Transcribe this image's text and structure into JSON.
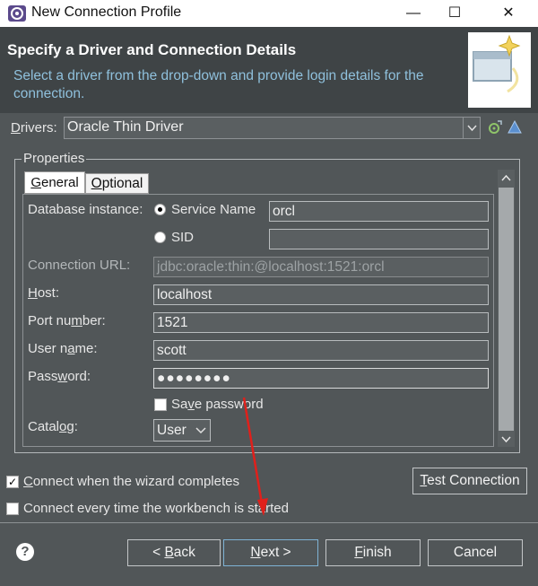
{
  "window": {
    "title": "New Connection Profile",
    "minimize_glyph": "—",
    "maximize_glyph": "☐",
    "close_glyph": "✕"
  },
  "header": {
    "title": "Specify a Driver and Connection Details",
    "description": "Select a driver from the drop-down and provide login details for the connection."
  },
  "drivers": {
    "label_first": "D",
    "label_rest": "rivers:",
    "selected": "Oracle Thin Driver"
  },
  "properties": {
    "group_label": "Properties",
    "tabs": [
      {
        "label_first": "G",
        "label_rest": "eneral",
        "active": true
      },
      {
        "label_first": "O",
        "label_rest": "ptional",
        "active": false
      }
    ],
    "database_instance_label": "Database instance:",
    "service_name_label": "Service Name",
    "service_name_value": "orcl",
    "sid_label": "SID",
    "sid_value": "",
    "connection_url_label": "Connection URL:",
    "connection_url_value": "jdbc:oracle:thin:@localhost:1521:orcl",
    "host_label_first": "H",
    "host_label_rest": "ost:",
    "host_value": "localhost",
    "port_label_pre": "Port nu",
    "port_label_ul": "m",
    "port_label_post": "ber:",
    "port_value": "1521",
    "username_label_pre": "User n",
    "username_label_ul": "a",
    "username_label_post": "me:",
    "username_value": "scott",
    "password_label_pre": "Pass",
    "password_label_ul": "w",
    "password_label_post": "ord:",
    "password_value": "●●●●●●●●",
    "save_password_pre": "Sa",
    "save_password_ul": "v",
    "save_password_post": "e password",
    "catalog_label_pre": "Catal",
    "catalog_label_ul": "o",
    "catalog_label_post": "g:",
    "catalog_value": "User"
  },
  "options": {
    "connect_on_finish_ul": "C",
    "connect_on_finish_rest": "onnect when the wizard completes",
    "connect_on_finish_checked": true,
    "connect_every_time": "Connect every time the workbench is started",
    "connect_every_time_checked": false,
    "test_connection_ul": "T",
    "test_connection_rest": "est Connection"
  },
  "footer": {
    "help_glyph": "?",
    "back_pre": "< ",
    "back_ul": "B",
    "back_post": "ack",
    "next_ul": "N",
    "next_post": "ext >",
    "finish_ul": "F",
    "finish_post": "inish",
    "cancel": "Cancel"
  },
  "colors": {
    "dialog_bg": "#515658",
    "header_bg": "#3f4446",
    "description_text": "#8fc0dc",
    "annotation_arrow": "#e0201b"
  }
}
